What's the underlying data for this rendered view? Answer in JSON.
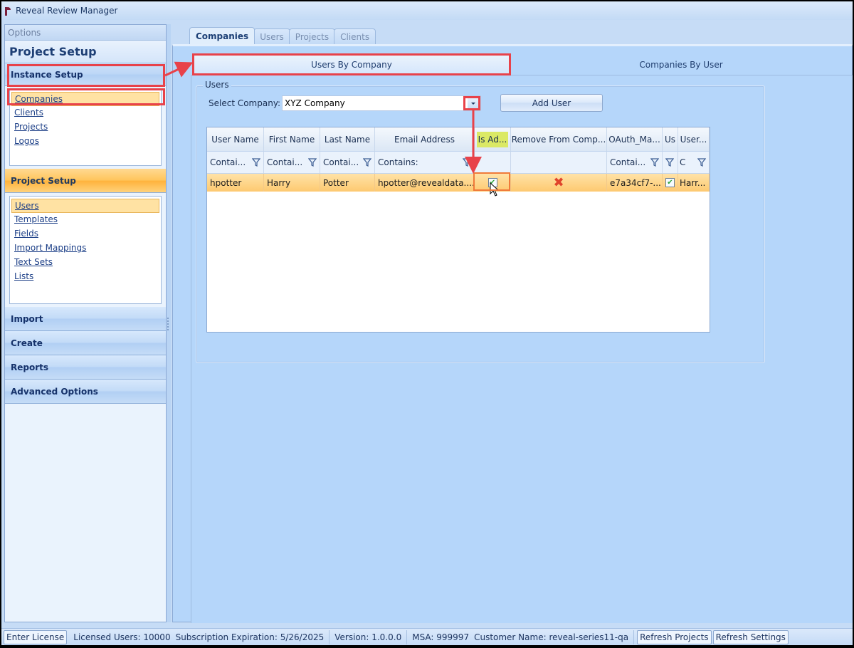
{
  "window": {
    "title": "Reveal Review Manager"
  },
  "sidebar": {
    "options_label": "Options",
    "header": "Project Setup",
    "instance_setup": {
      "label": "Instance Setup",
      "items": [
        {
          "label": "Companies",
          "selected": true
        },
        {
          "label": "Clients",
          "selected": false
        },
        {
          "label": "Projects",
          "selected": false
        },
        {
          "label": "Logos",
          "selected": false
        }
      ]
    },
    "project_setup": {
      "label": "Project Setup",
      "items": [
        {
          "label": "Users",
          "selected": true
        },
        {
          "label": "Templates",
          "selected": false
        },
        {
          "label": "Fields",
          "selected": false
        },
        {
          "label": "Import Mappings",
          "selected": false
        },
        {
          "label": "Text Sets",
          "selected": false
        },
        {
          "label": "Lists",
          "selected": false
        }
      ]
    },
    "groups": [
      "Import",
      "Create",
      "Reports",
      "Advanced Options"
    ]
  },
  "main": {
    "tabs": [
      {
        "label": "Companies",
        "active": true
      },
      {
        "label": "Users",
        "active": false
      },
      {
        "label": "Projects",
        "active": false
      },
      {
        "label": "Clients",
        "active": false
      }
    ],
    "subtabs": [
      {
        "label": "Users By Company",
        "active": true
      },
      {
        "label": "Companies By User",
        "active": false
      }
    ],
    "groupbox_label": "Users",
    "select_company_label": "Select Company:",
    "select_company_value": "XYZ Company",
    "add_user_label": "Add User",
    "grid": {
      "columns": [
        "User Name",
        "First Name",
        "Last Name",
        "Email Address",
        "Is Ad...",
        "Remove From Comp...",
        "OAuth_Ma...",
        "Us",
        "User..."
      ],
      "filters": [
        "Contai...",
        "Contai...",
        "Contai...",
        "Contains:",
        "",
        "",
        "Contai...",
        "",
        "C"
      ],
      "rows": [
        {
          "user_name": "hpotter",
          "first_name": "Harry",
          "last_name": "Potter",
          "email": "hpotter@revealdata....",
          "is_admin": true,
          "remove": "remove-x-icon",
          "oauth": "e7a34cf7-...",
          "us": true,
          "user_display": "Harr..."
        }
      ]
    }
  },
  "statusbar": {
    "enter_license": "Enter License",
    "licensed_users": "Licensed Users: 10000",
    "subscription": "Subscription Expiration: 5/26/2025",
    "version": "Version: 1.0.0.0",
    "msa": "MSA: 999997",
    "customer": "Customer Name: reveal-series11-qa",
    "refresh_projects": "Refresh Projects",
    "refresh_settings": "Refresh Settings"
  },
  "annotation_color": "#e8424a"
}
